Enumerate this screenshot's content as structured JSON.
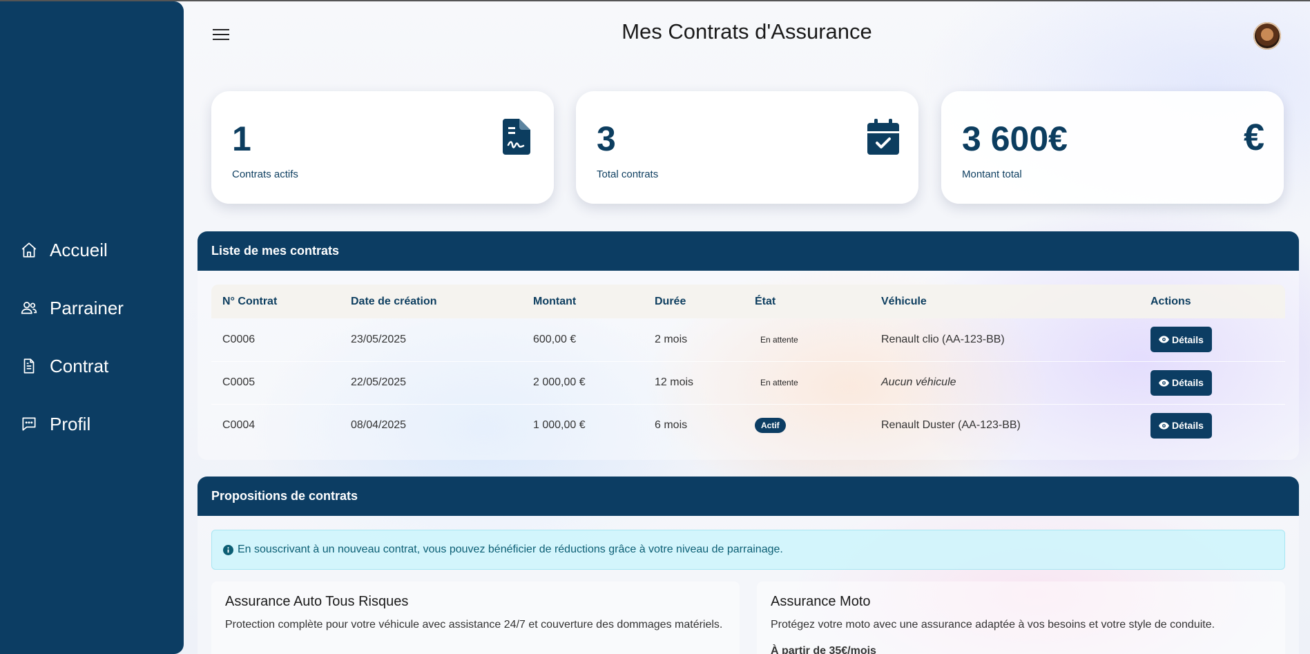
{
  "sidebar": {
    "items": [
      {
        "label": "Accueil",
        "icon": "home-icon"
      },
      {
        "label": "Parrainer",
        "icon": "users-icon"
      },
      {
        "label": "Contrat",
        "icon": "document-icon"
      },
      {
        "label": "Profil",
        "icon": "chat-icon"
      }
    ]
  },
  "header": {
    "title": "Mes Contrats d'Assurance"
  },
  "stats": [
    {
      "value": "1",
      "label": "Contrats actifs",
      "icon": "signed-document-icon"
    },
    {
      "value": "3",
      "label": "Total contrats",
      "icon": "calendar-check-icon"
    },
    {
      "value": "3 600€",
      "label": "Montant total",
      "icon": "euro-icon"
    }
  ],
  "contracts": {
    "title": "Liste de mes contrats",
    "columns": [
      "N° Contrat",
      "Date de création",
      "Montant",
      "Durée",
      "État",
      "Véhicule",
      "Actions"
    ],
    "rows": [
      {
        "number": "C0006",
        "date": "23/05/2025",
        "amount": "600,00 €",
        "duration": "2 mois",
        "state": "En attente",
        "vehicle": "Renault clio (AA-123-BB)",
        "action": "Détails"
      },
      {
        "number": "C0005",
        "date": "22/05/2025",
        "amount": "2 000,00 €",
        "duration": "12 mois",
        "state": "En attente",
        "vehicle": "Aucun véhicule",
        "action": "Détails"
      },
      {
        "number": "C0004",
        "date": "08/04/2025",
        "amount": "1 000,00 €",
        "duration": "6 mois",
        "state": "Actif",
        "vehicle": "Renault Duster (AA-123-BB)",
        "action": "Détails"
      }
    ]
  },
  "proposals": {
    "title": "Propositions de contrats",
    "info": "En souscrivant à un nouveau contrat, vous pouvez bénéficier de réductions grâce à votre niveau de parrainage.",
    "offers": [
      {
        "title": "Assurance Auto Tous Risques",
        "description": "Protection complète pour votre véhicule avec assistance 24/7 et couverture des dommages matériels."
      },
      {
        "title": "Assurance Moto",
        "description": "Protégez votre moto avec une assurance adaptée à vos besoins et votre style de conduite.",
        "price": "À partir de 35€/mois"
      }
    ]
  },
  "colors": {
    "primary": "#0c3d63",
    "info_bg": "#ccf4fb",
    "info_text": "#0b5e74"
  }
}
